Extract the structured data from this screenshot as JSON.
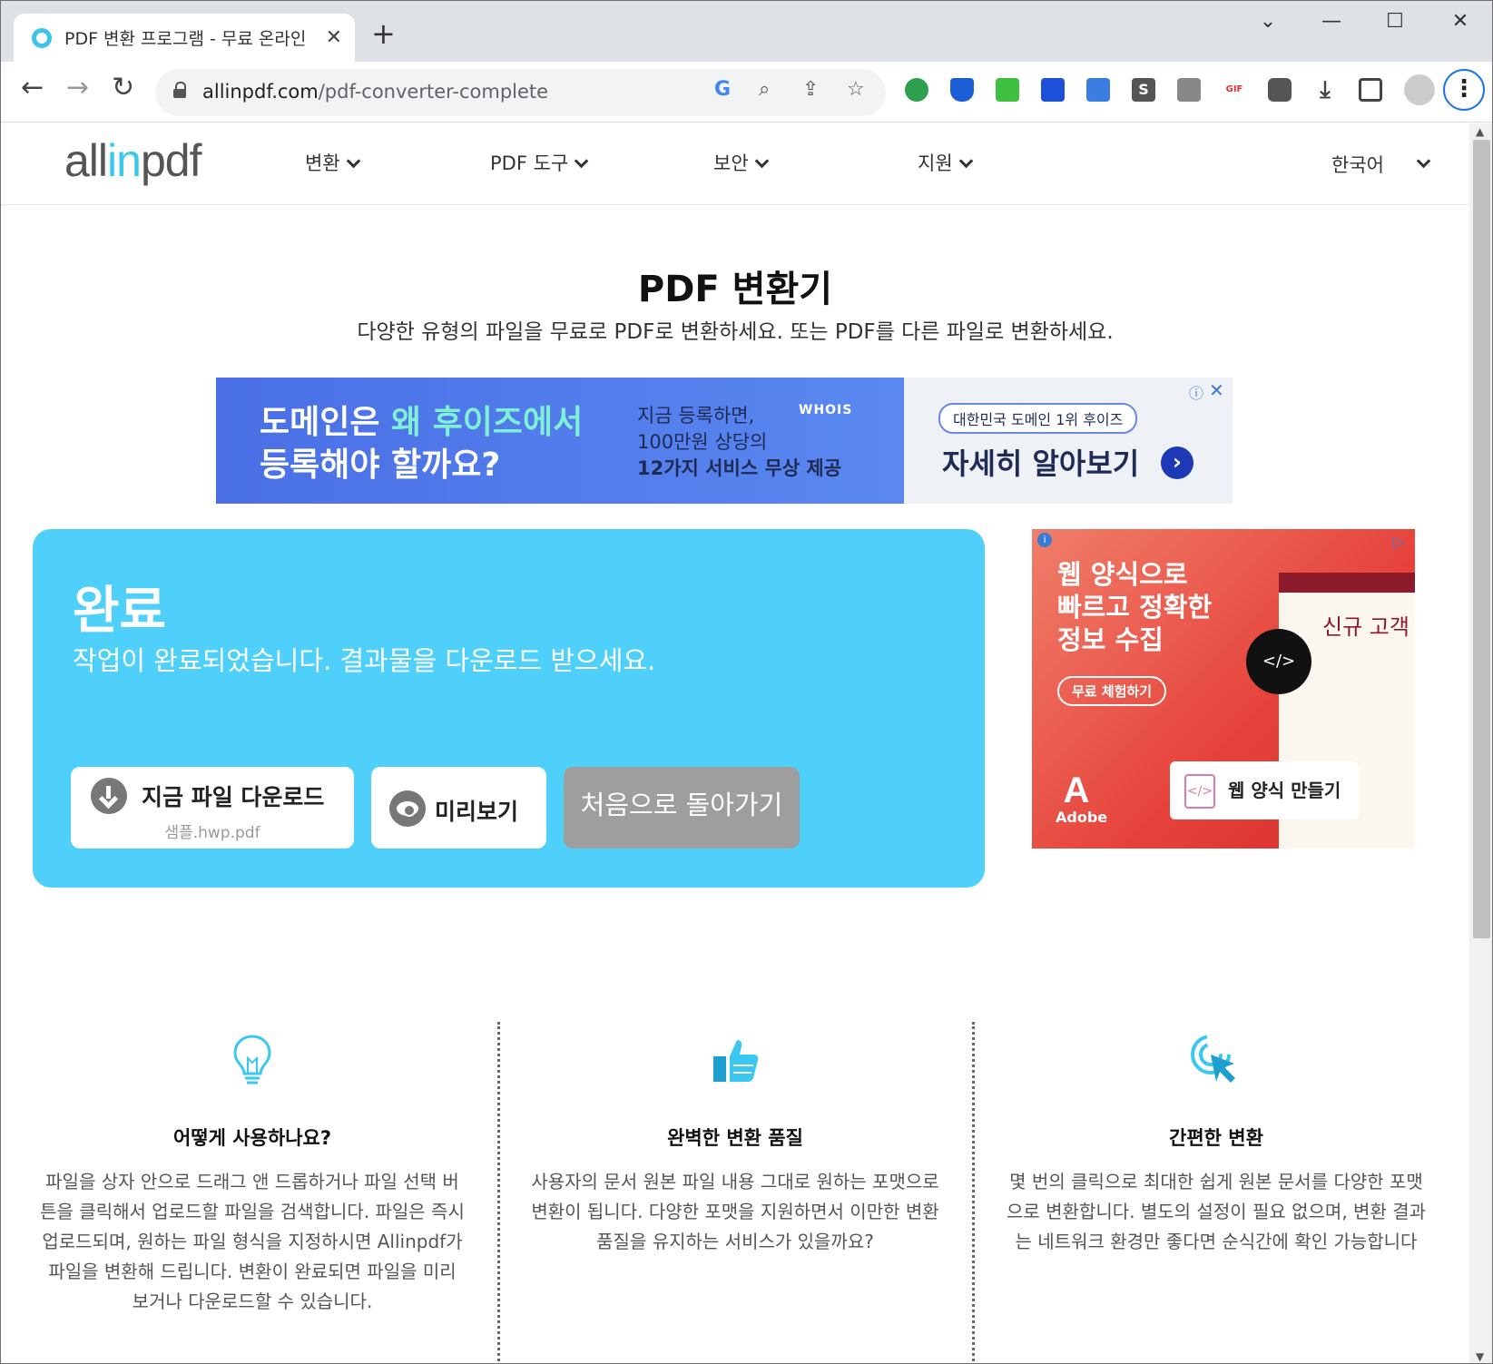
{
  "browser": {
    "tab_title": "PDF 변환 프로그램 - 무료 온라인",
    "tab_close": "✕",
    "new_tab": "+",
    "url_host": "allinpdf.com",
    "url_path": "/pdf-converter-complete",
    "window_controls": {
      "tab_search": "⌄",
      "minimize": "—",
      "maximize": "☐",
      "close": "✕"
    },
    "nav": {
      "back": "←",
      "forward": "→",
      "reload": "↻"
    },
    "omnibox_icons": [
      "google-g-icon",
      "zoom-icon",
      "share-icon",
      "bookmark-star-icon"
    ],
    "menu": "⋮"
  },
  "site": {
    "logo_a": "all",
    "logo_in": "in",
    "logo_b": "pdf",
    "nav": [
      {
        "label": "변환"
      },
      {
        "label": "PDF 도구"
      },
      {
        "label": "보안"
      },
      {
        "label": "지원"
      }
    ],
    "language": "한국어"
  },
  "hero": {
    "title": "PDF 변환기",
    "subtitle": "다양한 유형의 파일을 무료로 PDF로 변환하세요. 또는 PDF를 다른 파일로 변환하세요."
  },
  "ad_top": {
    "headline_1a": "도메인은 ",
    "headline_1b": "왜 후이즈에서",
    "headline_2": "등록해야 할까요?",
    "mid_1": "지금 등록하면,",
    "mid_2": "100만원 상당의",
    "mid_3": "12가지 서비스 무상 제공",
    "brand": "WHOIS",
    "badge": "대한민국 도메인 1위 후이즈",
    "cta": "자세히 알아보기",
    "arrow": "›",
    "info": "ⓘ",
    "close": "✕"
  },
  "result": {
    "title": "완료",
    "message": "작업이 완료되었습니다. 결과물을 다운로드 받으세요.",
    "download_label": "지금 파일 다운로드",
    "download_file": "샘플.hwp.pdf",
    "preview_label": "미리보기",
    "restart_label": "처음으로 돌아가기"
  },
  "ad_side": {
    "headline_1": "웹 양식으로",
    "headline_2": "빠르고 정확한",
    "headline_3": "정보 수집",
    "trial_button": "무료 체험하기",
    "form_text": "신규 고객",
    "code_symbol": "</>",
    "make_label": "웹 양식 만들기",
    "make_icon_symbol": "</>",
    "brand": "Adobe",
    "brand_mark": "A",
    "info": "i",
    "play": "▷"
  },
  "features": [
    {
      "icon": "lightbulb-icon",
      "title": "어떻게 사용하나요?",
      "desc": "파일을 상자 안으로 드래그 앤 드롭하거나 파일 선택 버튼을 클릭해서 업로드할 파일을 검색합니다. 파일은 즉시 업로드되며, 원하는 파일 형식을 지정하시면 Allinpdf가 파일을 변환해 드립니다. 변환이 완료되면 파일을 미리 보거나 다운로드할 수 있습니다."
    },
    {
      "icon": "thumbs-up-icon",
      "title": "완벽한 변환 품질",
      "desc": "사용자의 문서 원본 파일 내용 그대로 원하는 포맷으로 변환이 됩니다. 다양한 포맷을 지원하면서 이만한 변환 품질을 유지하는 서비스가 있을까요?"
    },
    {
      "icon": "click-cursor-icon",
      "title": "간편한 변환",
      "desc": "몇 번의 클릭으로 최대한 쉽게 원본 문서를 다양한 포맷으로 변환합니다. 별도의 설정이 필요 없으며, 변환 결과는 네트워크 환경만 좋다면 순식간에 확인 가능합니다"
    }
  ],
  "colors": {
    "accent": "#4fd0fb",
    "brand_cyan": "#3bc8f0",
    "restart_gray": "#9e9e9e"
  }
}
